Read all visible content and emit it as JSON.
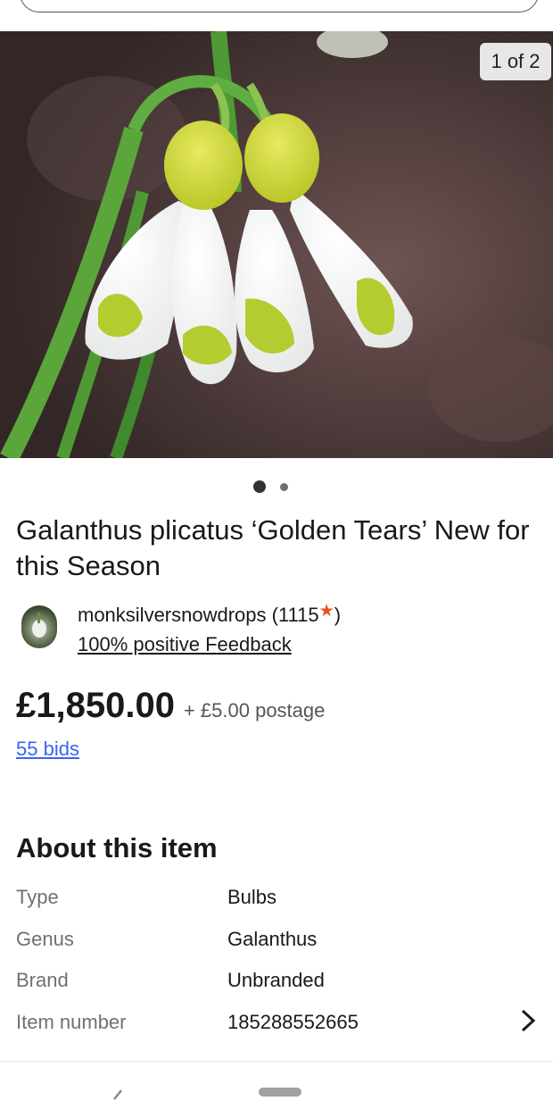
{
  "gallery": {
    "counter": "1 of 2",
    "total_images": 2,
    "active_index": 1
  },
  "listing": {
    "title": "Galanthus plicatus ‘Golden Tears’ New for this Season",
    "price": "£1,850.00",
    "postage": "+ £5.00 postage",
    "bids": "55 bids"
  },
  "seller": {
    "name_prefix": "monksilversnowdrops (1115",
    "name_suffix": ")",
    "star_icon": "star-icon",
    "feedback": "100% positive Feedback"
  },
  "about": {
    "heading": "About this item",
    "specs": [
      {
        "label": "Type",
        "value": "Bulbs"
      },
      {
        "label": "Genus",
        "value": "Galanthus"
      },
      {
        "label": "Brand",
        "value": "Unbranded"
      },
      {
        "label": "Item number",
        "value": "185288552665"
      }
    ]
  },
  "colors": {
    "link": "#3665f3",
    "star": "#e8501a",
    "text": "#191919",
    "muted": "#707070"
  }
}
